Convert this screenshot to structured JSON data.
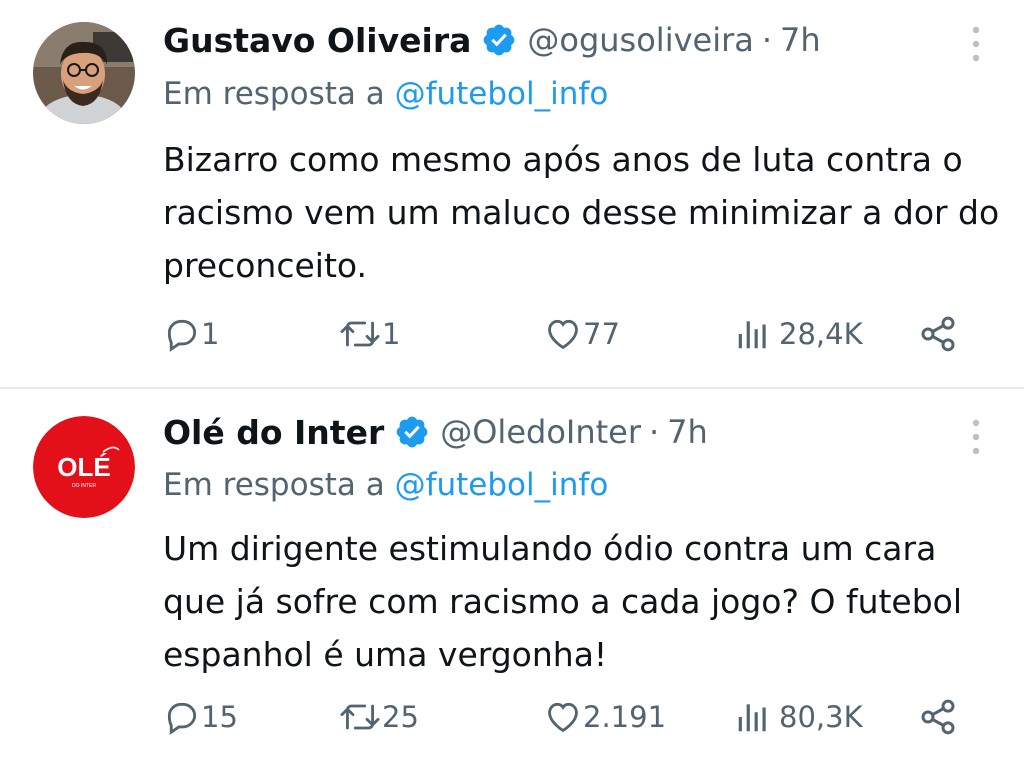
{
  "tweets": [
    {
      "author": "Gustavo Oliveira",
      "handle": "@ogusoliveira",
      "separator": "·",
      "time": "7h",
      "reply_prefix": "Em resposta a",
      "reply_to": "@futebol_info",
      "text": "Bizarro como mesmo após anos de luta contra o racismo vem um maluco desse minimizar a dor do preconceito.",
      "replies": "1",
      "retweets": "1",
      "likes": "77",
      "views": "28,4K",
      "avatar": "profile-photo"
    },
    {
      "author": "Olé do Inter",
      "handle": "@OledoInter",
      "separator": "·",
      "time": "7h",
      "reply_prefix": "Em resposta a",
      "reply_to": "@futebol_info",
      "text": "Um dirigente estimulando ódio contra um cara que já sofre com racismo a cada jogo? O futebol espanhol é uma vergonha!",
      "replies": "15",
      "retweets": "25",
      "likes": "2.191",
      "views": "80,3K",
      "avatar": "ole-logo",
      "avatar_logo_text": "OLÉ",
      "avatar_logo_subtext": "DO INTER"
    }
  ],
  "icons": {
    "verified": "verified-badge-icon",
    "more": "more-vertical-icon",
    "reply": "reply-bubble-icon",
    "retweet": "retweet-icon",
    "like": "heart-icon",
    "views": "views-bar-chart-icon",
    "share": "share-icon"
  },
  "colors": {
    "text": "#0f1419",
    "secondary": "#536471",
    "link": "#1d9bf0",
    "verified": "#1d9bf0",
    "divider": "#e7e9ea",
    "ole_red": "#e3101a"
  }
}
